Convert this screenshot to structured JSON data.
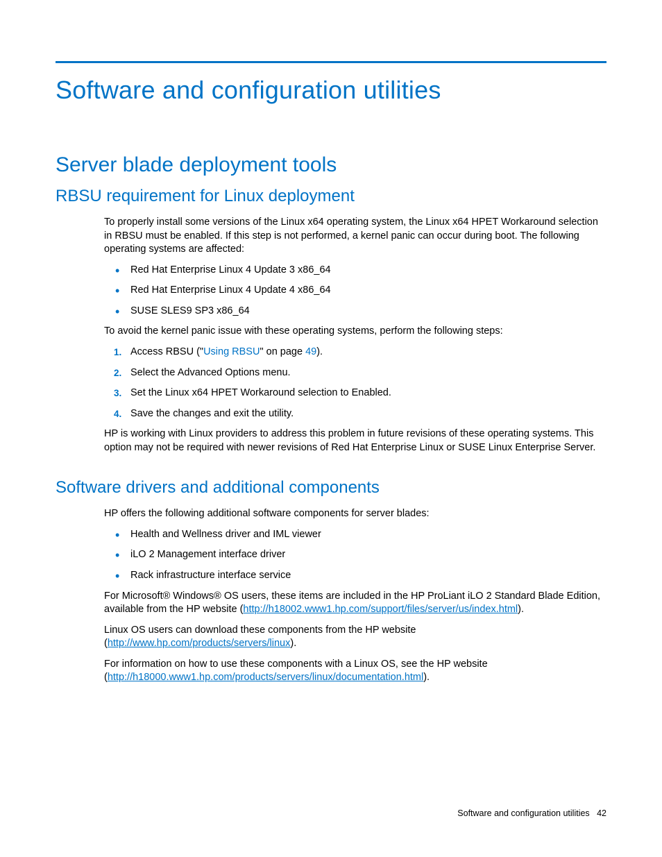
{
  "chapter_title": "Software and configuration utilities",
  "section1": {
    "title": "Server blade deployment tools",
    "sub1": {
      "title": "RBSU requirement for Linux deployment",
      "intro": "To properly install some versions of the Linux x64 operating system, the Linux x64 HPET Workaround selection in RBSU must be enabled. If this step is not performed, a kernel panic can occur during boot. The following operating systems are affected:",
      "os_list": [
        "Red Hat Enterprise Linux 4 Update 3 x86_64",
        "Red Hat Enterprise Linux 4 Update 4 x86_64",
        "SUSE SLES9 SP3 x86_64"
      ],
      "avoid_intro": "To avoid the kernel panic issue with these operating systems, perform the following steps:",
      "step1_prefix": "Access RBSU (\"",
      "step1_link": "Using RBSU",
      "step1_mid": "\" on page ",
      "step1_page": "49",
      "step1_suffix": ").",
      "steps_rest": [
        "Select the Advanced Options menu.",
        "Set the Linux x64 HPET Workaround selection to Enabled.",
        "Save the changes and exit the utility."
      ],
      "closing": "HP is working with Linux providers to address this problem in future revisions of these operating systems. This option may not be required with newer revisions of Red Hat Enterprise Linux or SUSE Linux Enterprise Server."
    },
    "sub2": {
      "title": "Software drivers and additional components",
      "intro": "HP offers the following additional software components for server blades:",
      "components": [
        "Health and Wellness driver and IML viewer",
        "iLO 2 Management interface driver",
        "Rack infrastructure interface service"
      ],
      "ms_para_prefix": "For Microsoft® Windows® OS users, these items are included in the HP ProLiant iLO 2 Standard Blade Edition, available from the HP website (",
      "ms_link": "http://h18002.www1.hp.com/support/files/server/us/index.html",
      "ms_para_suffix": ").",
      "linux_dl_prefix": "Linux OS users can download these components from the HP website (",
      "linux_dl_link": "http://www.hp.com/products/servers/linux",
      "linux_dl_suffix": ").",
      "linux_info_prefix": "For information on how to use these components with a Linux OS, see the HP website (",
      "linux_info_link": "http://h18000.www1.hp.com/products/servers/linux/documentation.html",
      "linux_info_suffix": ")."
    }
  },
  "footer": {
    "label": "Software and configuration utilities",
    "page": "42"
  }
}
